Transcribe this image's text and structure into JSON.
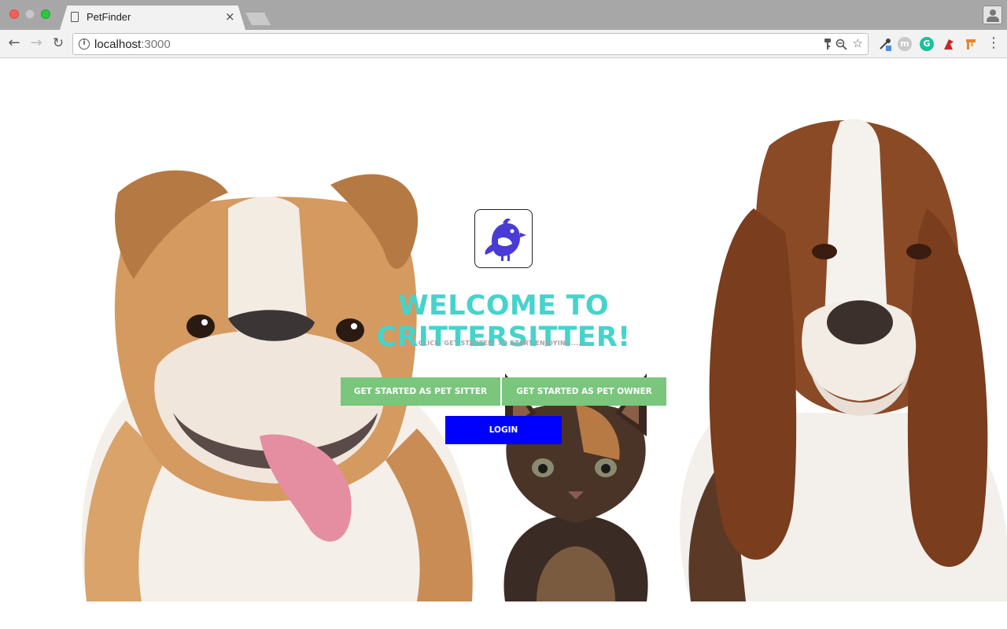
{
  "browser": {
    "tab_title": "PetFinder",
    "tab_close": "×",
    "url_host": "localhost",
    "url_port": ":3000",
    "ext_m_label": "m",
    "ext_g_label": "G"
  },
  "hero": {
    "headline": "WELCOME TO CRITTERSITTER!",
    "subline": "CLICK 'GET STARTED' TO START ENJOYING.......",
    "buttons": {
      "sitter": "GET STARTED AS PET SITTER",
      "owner": "GET STARTED AS PET OWNER",
      "login": "LOGIN"
    }
  },
  "colors": {
    "headline": "#46d3cc",
    "primary_buttons": "#79c67c",
    "login_button": "#0000ff",
    "logo_bird": "#4a3ad6"
  },
  "icons": {
    "logo": "bird-icon",
    "nav": [
      "back-arrow-icon",
      "forward-arrow-icon",
      "reload-icon"
    ],
    "omnibox": [
      "info-icon",
      "key-icon",
      "zoom-icon",
      "star-icon"
    ],
    "extensions": [
      "eyedropper-icon",
      "m-extension-icon",
      "grammarly-icon",
      "red-extension-icon",
      "orange-extension-icon"
    ]
  }
}
